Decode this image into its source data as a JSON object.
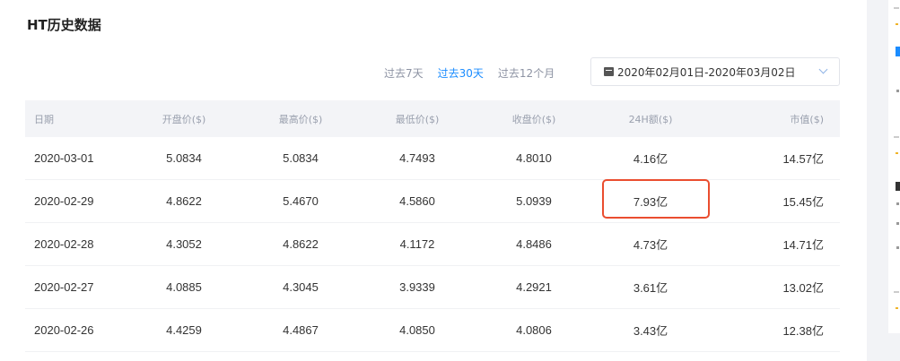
{
  "page": {
    "title": "HT历史数据"
  },
  "filters": {
    "periods": [
      "过去7天",
      "过去30天",
      "过去12个月"
    ],
    "active_index": 1,
    "date_range": "2020年02月01日-2020年03月02日"
  },
  "table": {
    "headers": [
      "日期",
      "开盘价($)",
      "最高价($)",
      "最低价($)",
      "收盘价($)",
      "24H额($)",
      "市值($)"
    ],
    "rows": [
      [
        "2020-03-01",
        "5.0834",
        "5.0834",
        "4.7493",
        "4.8010",
        "4.16亿",
        "14.57亿"
      ],
      [
        "2020-02-29",
        "4.8622",
        "5.4670",
        "4.5860",
        "5.0939",
        "7.93亿",
        "15.45亿"
      ],
      [
        "2020-02-28",
        "4.3052",
        "4.8622",
        "4.1172",
        "4.8486",
        "4.73亿",
        "14.71亿"
      ],
      [
        "2020-02-27",
        "4.0885",
        "4.3045",
        "3.9339",
        "4.2921",
        "3.61亿",
        "13.02亿"
      ],
      [
        "2020-02-26",
        "4.4259",
        "4.4867",
        "4.0850",
        "4.0806",
        "3.43亿",
        "12.38亿"
      ]
    ]
  },
  "highlight": {
    "row_index": 1,
    "col_index": 5,
    "color": "#ea4d2f"
  },
  "colors": {
    "accent": "#1a8cff",
    "muted": "#8d93a3",
    "header_bg": "#f3f4f7"
  }
}
